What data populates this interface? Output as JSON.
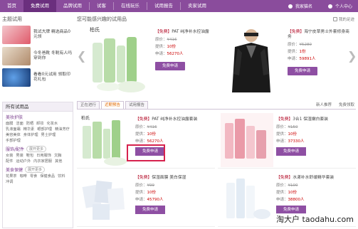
{
  "nav": {
    "items": [
      "首页",
      "免费试用",
      "品牌试用",
      "试客",
      "在线玩乐",
      "试用报告",
      "卖家试用"
    ],
    "active_index": 1,
    "username": "我家猫名",
    "center": "个人中心"
  },
  "left": {
    "title": "主题试用",
    "promos": [
      {
        "text": "我试大牌 精选商品0元领",
        "color": "#e05a6a"
      },
      {
        "text": "今冬爸靴 冬靴有人吗穿到你",
        "color": "#b08a6a"
      },
      {
        "text": "看看0元试用 领取印花礼包",
        "color": "#2a5fa8"
      }
    ]
  },
  "categories": {
    "title": "所有试用品",
    "groups": [
      {
        "title": "美妆护肤",
        "more": "",
        "tags": [
          "面膜",
          "洁面",
          "防晒",
          "卸妆",
          "化妆水",
          "乳液面霜",
          "精华素",
          "眼部护理",
          "精油芳疗",
          "美容美体",
          "身体护理",
          "男士护理",
          "手部护理"
        ]
      },
      {
        "title": "服饰/配件",
        "more": "展开更多",
        "tags": [
          "女装",
          "男装",
          "鞋包",
          "日用服饰",
          "文胸",
          "配件",
          "运动户外",
          "内衣家居服",
          "其他"
        ]
      },
      {
        "title": "美食保健",
        "more": "展开更多",
        "tags": [
          "花果茶",
          "咖啡",
          "零食",
          "保健食品",
          "饮料",
          "冲调"
        ]
      }
    ]
  },
  "main": {
    "title": "您可能感兴趣的试用品",
    "history": "我的足迹"
  },
  "carousel": [
    {
      "title_prefix": "【免费】",
      "title": "PAT 纯净补水控油露",
      "price_label": "原价：",
      "price": "¥416",
      "count_label": "提供：",
      "count": "10份",
      "apply_label": "申请：",
      "apply": "56270人",
      "button": "免费申请"
    },
    {
      "title_prefix": "【免费】",
      "title": "海宁皮草男士外套修身商务",
      "price_label": "原价：",
      "price": "¥5280",
      "count_label": "提供：",
      "count": "1份",
      "apply_label": "申请：",
      "apply": "59891人",
      "button": "免费申请"
    }
  ],
  "tabs": {
    "items": [
      "正在进行",
      "近期预告",
      "试用报告"
    ],
    "active_index": 1,
    "right": [
      "新人推荐",
      "免费领取"
    ]
  },
  "grid": [
    {
      "title_prefix": "【免费】",
      "title": "PAT 纯净补水控油露套装",
      "price_label": "原价：",
      "price": "¥416",
      "count_label": "提供：",
      "count": "10份",
      "apply_label": "申请：",
      "apply": "56270人",
      "button": "免费申请"
    },
    {
      "title_prefix": "【免费】",
      "title": "3合1 保湿嫩白套装",
      "price_label": "原价：",
      "price": "¥150",
      "count_label": "提供：",
      "count": "10份",
      "apply_label": "申请：",
      "apply": "37330人",
      "button": "免费申请"
    },
    {
      "title_prefix": "【免费】",
      "title": "保湿面膜 美白保湿",
      "price_label": "原价：",
      "price": "¥99",
      "count_label": "提供：",
      "count": "10份",
      "apply_label": "申请：",
      "apply": "45790人",
      "button": "免费申请"
    },
    {
      "title_prefix": "【免费】",
      "title": "水漾补水舒缓精华套装",
      "price_label": "原价：",
      "price": "¥100",
      "count_label": "提供：",
      "count": "10份",
      "apply_label": "申请：",
      "apply": "38800人",
      "button": "免费申请"
    }
  ],
  "watermark": "淘大户 taodahu.com",
  "colors": {
    "nav": "#8a4c9c",
    "button": "#8e4fa3",
    "highlight": "#d6224d"
  }
}
